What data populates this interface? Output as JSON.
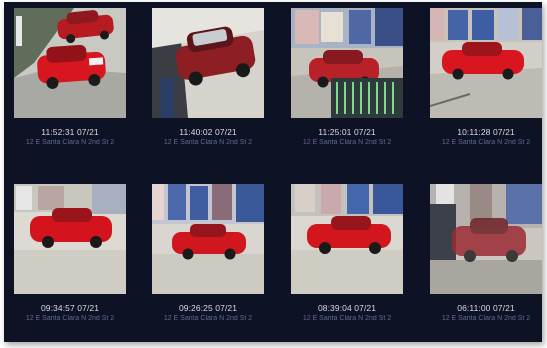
{
  "gallery": {
    "items": [
      {
        "time": "11:52:31 07/21",
        "location": "12 E Santa Clara N 2nd St 2"
      },
      {
        "time": "11:40:02 07/21",
        "location": "12 E Santa Clara N 2nd St 2"
      },
      {
        "time": "11:25:01 07/21",
        "location": "12 E Santa Clara N 2nd St 2"
      },
      {
        "time": "10:11:28 07/21",
        "location": "12 E Santa Clara N 2nd St 2"
      },
      {
        "time": "09:34:57 07/21",
        "location": "12 E Santa Clara N 2nd St 2"
      },
      {
        "time": "09:26:25 07/21",
        "location": "12 E Santa Clara N 2nd St 2"
      },
      {
        "time": "08:39:04 07/21",
        "location": "12 E Santa Clara N 2nd St 2"
      },
      {
        "time": "06:11:00 07/21",
        "location": "12 E Santa Clara N 2nd St 2"
      }
    ]
  },
  "colors": {
    "background": "#0d1325",
    "timestamp_text": "#d6dbe6",
    "location_text": "#5d6b8a",
    "vehicle": "#c8141c"
  }
}
